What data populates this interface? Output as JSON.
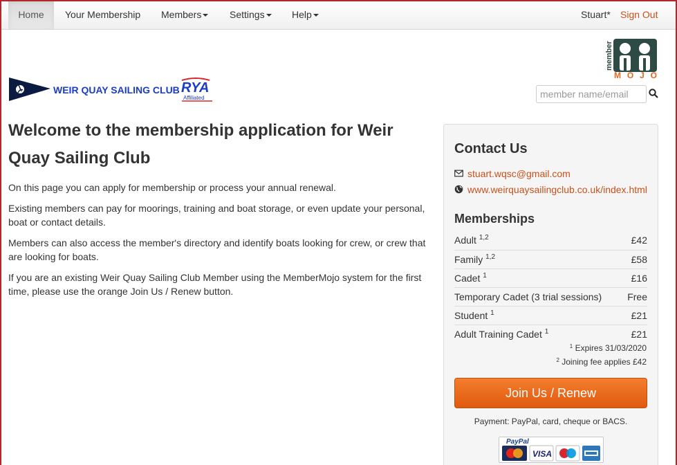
{
  "nav": {
    "home": "Home",
    "your_membership": "Your Membership",
    "members": "Members",
    "settings": "Settings",
    "help": "Help",
    "user": "Stuart*",
    "sign_out": "Sign Out"
  },
  "header": {
    "club_name": "WEIR QUAY SAILING CLUB",
    "rya": "RYA",
    "rya_sub": "Affiliated",
    "mm_top": "member",
    "mm_bottom": "MOJO",
    "search_placeholder": "member name/email"
  },
  "main": {
    "title": "Welcome to the membership application for Weir Quay Sailing Club",
    "paragraphs": [
      "On this page you can apply for membership or process your annual renewal.",
      "Existing members can pay for moorings, training and boat storage, or even update your personal, boat or contact details.",
      "Members can also access the member's directory and identify boats looking for crew, or crew that are looking for boats.",
      "If you are an existing Weir Quay Sailing Club Member using the MemberMojo system for the first time, please use the orange Join Us / Renew button."
    ]
  },
  "sidebar": {
    "contact_title": "Contact Us",
    "email": "stuart.wqsc@gmail.com",
    "website": "www.weirquaysailingclub.co.uk/index.html",
    "memberships_title": "Memberships",
    "memberships": [
      {
        "name": "Adult",
        "sup": "1,2",
        "price": "£42"
      },
      {
        "name": "Family",
        "sup": "1,2",
        "price": "£58"
      },
      {
        "name": "Cadet",
        "sup": "1",
        "price": "£16"
      },
      {
        "name": "Temporary Cadet (3 trial sessions)",
        "sup": "",
        "price": "Free"
      },
      {
        "name": "Student",
        "sup": "1",
        "price": "£21"
      },
      {
        "name": "Adult Training Cadet",
        "sup": "1",
        "price": "£21"
      }
    ],
    "note1_sup": "1",
    "note1": "Expires 31/03/2020",
    "note2_sup": "2",
    "note2": "Joining fee applies £42",
    "join_button": "Join Us / Renew",
    "payment_text": "Payment: PayPal, card, cheque or BACS.",
    "paypal": "PayPal",
    "card_visa": "VISA"
  },
  "colors": {
    "accent_orange": "#e8661a",
    "link": "#c7501a",
    "club_blue": "#1a3cc8"
  }
}
